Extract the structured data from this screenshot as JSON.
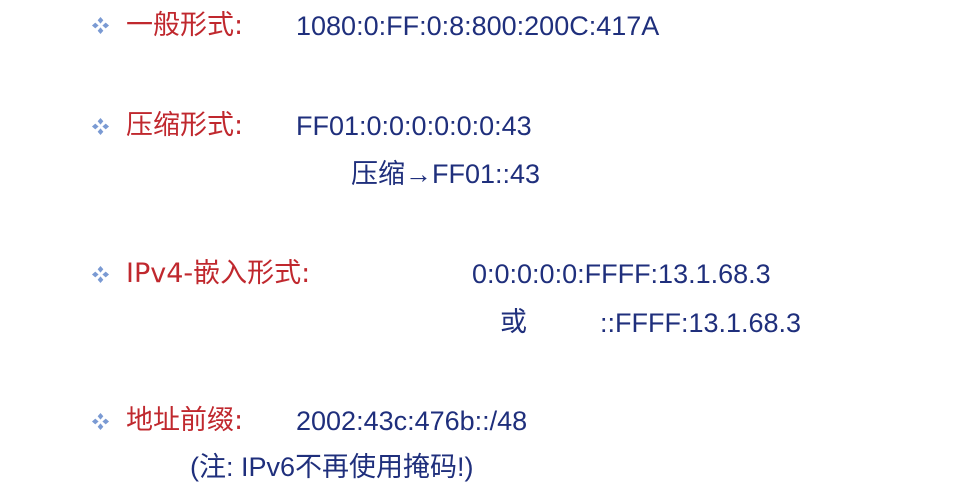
{
  "colors": {
    "label": "#c0282e",
    "value": "#1f2f7c",
    "bullet": "#7a9ad3"
  },
  "items": [
    {
      "bullet_icon": "diamond-bullet-icon",
      "label": "一般形式:",
      "value": "1080:0:FF:0:8:800:200C:417A"
    },
    {
      "bullet_icon": "diamond-bullet-icon",
      "label": "压缩形式:",
      "value": "FF01:0:0:0:0:0:0:43",
      "line2": "压缩→FF01::43"
    },
    {
      "bullet_icon": "diamond-bullet-icon",
      "label": "IPv4-嵌入形式:",
      "value": "0:0:0:0:0:FFFF:13.1.68.3",
      "or_label": "或",
      "alt_value": "::FFFF:13.1.68.3"
    },
    {
      "bullet_icon": "diamond-bullet-icon",
      "label": "地址前缀:",
      "value": "2002:43c:476b::/48",
      "note": "(注: IPv6不再使用掩码!)"
    }
  ]
}
